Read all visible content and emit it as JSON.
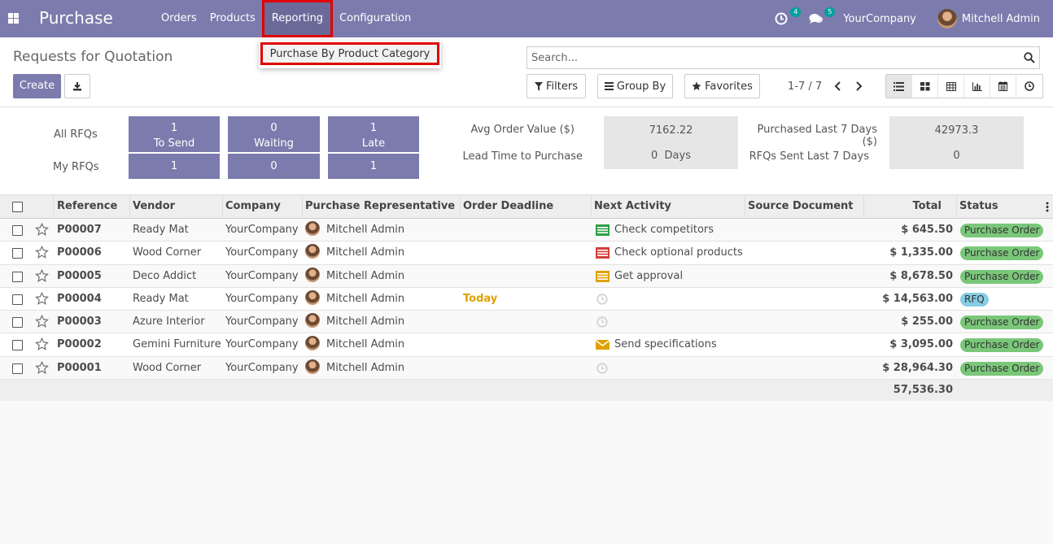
{
  "navbar": {
    "brand": "Purchase",
    "menu": [
      "Orders",
      "Products",
      "Reporting",
      "Configuration"
    ],
    "activity_count": "4",
    "message_count": "5",
    "company": "YourCompany",
    "user": "Mitchell Admin"
  },
  "dropdown": {
    "item": "Purchase By Product Category"
  },
  "control_panel": {
    "title": "Requests for Quotation",
    "create_label": "Create",
    "search_placeholder": "Search...",
    "filters_label": "Filters",
    "group_by_label": "Group By",
    "favorites_label": "Favorites",
    "pager": "1-7 / 7"
  },
  "dashboard": {
    "all_rfqs_label": "All RFQs",
    "my_rfqs_label": "My RFQs",
    "tiles_all": [
      {
        "count": "1",
        "label": "To Send"
      },
      {
        "count": "0",
        "label": "Waiting"
      },
      {
        "count": "1",
        "label": "Late"
      }
    ],
    "tiles_my": [
      "1",
      "0",
      "1"
    ],
    "stats": {
      "avg_order_label": "Avg Order Value ($)",
      "avg_order_value": "7162.22",
      "lead_time_label": "Lead Time to Purchase",
      "lead_time_value": "0  Days",
      "purchased_label": "Purchased Last 7 Days ($)",
      "purchased_value": "42973.3",
      "rfqs_sent_label": "RFQs Sent Last 7 Days",
      "rfqs_sent_value": "0"
    }
  },
  "table": {
    "columns": [
      "Reference",
      "Vendor",
      "Company",
      "Purchase Representative",
      "Order Deadline",
      "Next Activity",
      "Source Document",
      "Total",
      "Status"
    ],
    "rows": [
      {
        "ref": "P00007",
        "vendor": "Ready Mat",
        "company": "YourCompany",
        "rep": "Mitchell Admin",
        "deadline": "",
        "activity": "Check competitors",
        "activity_icon": "todo-green-icon",
        "total": "$ 645.50",
        "status": "Purchase Order"
      },
      {
        "ref": "P00006",
        "vendor": "Wood Corner",
        "company": "YourCompany",
        "rep": "Mitchell Admin",
        "deadline": "",
        "activity": "Check optional products",
        "activity_icon": "todo-red-icon",
        "total": "$ 1,335.00",
        "status": "Purchase Order"
      },
      {
        "ref": "P00005",
        "vendor": "Deco Addict",
        "company": "YourCompany",
        "rep": "Mitchell Admin",
        "deadline": "",
        "activity": "Get approval",
        "activity_icon": "todo-yellow-icon",
        "total": "$ 8,678.50",
        "status": "Purchase Order"
      },
      {
        "ref": "P00004",
        "vendor": "Ready Mat",
        "company": "YourCompany",
        "rep": "Mitchell Admin",
        "deadline": "Today",
        "activity": "",
        "activity_icon": "clock-icon",
        "total": "$ 14,563.00",
        "status": "RFQ"
      },
      {
        "ref": "P00003",
        "vendor": "Azure Interior",
        "company": "YourCompany",
        "rep": "Mitchell Admin",
        "deadline": "",
        "activity": "",
        "activity_icon": "clock-icon",
        "total": "$ 255.00",
        "status": "Purchase Order"
      },
      {
        "ref": "P00002",
        "vendor": "Gemini Furniture",
        "company": "YourCompany",
        "rep": "Mitchell Admin",
        "deadline": "",
        "activity": "Send specifications",
        "activity_icon": "envelope-icon",
        "total": "$ 3,095.00",
        "status": "Purchase Order"
      },
      {
        "ref": "P00001",
        "vendor": "Wood Corner",
        "company": "YourCompany",
        "rep": "Mitchell Admin",
        "deadline": "",
        "activity": "",
        "activity_icon": "clock-icon",
        "total": "$ 28,964.30",
        "status": "Purchase Order"
      }
    ],
    "sum_total": "57,536.30"
  },
  "colors": {
    "brand": "#7c7bad",
    "highlight": "#e00000",
    "status_po": "#7ac77a",
    "status_rfq": "#87cde3",
    "today": "#e1a100"
  }
}
